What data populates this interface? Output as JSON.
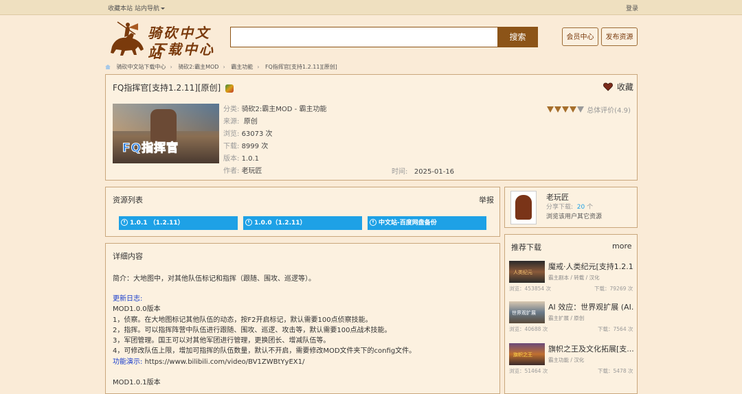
{
  "topbar": {
    "favorite": "收藏本站",
    "site_nav": "站内导航",
    "login": "登录"
  },
  "logo": {
    "line1": "骑砍中文站",
    "line2": "下载中心"
  },
  "search": {
    "placeholder": "",
    "button": "搜索"
  },
  "header_buttons": {
    "member": "会员中心",
    "publish": "发布资源"
  },
  "breadcrumb": [
    "骑砍中文站下载中心",
    "骑砍2:霸主MOD",
    "霸主功能",
    "FQ指挥官[支持1.2.11][原创]"
  ],
  "resource": {
    "title": "FQ指挥官[支持1.2.11][原创]",
    "favorite_label": "收藏",
    "thumb_text": "FQ指挥官",
    "rating_label": "总体评价(4.9)",
    "rating_value": 4.9,
    "fields": {
      "category": {
        "label": "分类:",
        "value": "骑砍2:霸主MOD - 霸主功能"
      },
      "source": {
        "label": "来源:",
        "value": "原创"
      },
      "views": {
        "label": "浏览:",
        "value": "63073 次"
      },
      "downloads": {
        "label": "下载:",
        "value": "8999 次"
      },
      "version": {
        "label": "版本:",
        "value": "1.0.1"
      },
      "author": {
        "label": "作者:",
        "value": "老玩匠"
      },
      "time": {
        "label": "时间:",
        "value": "2025-01-16"
      }
    }
  },
  "resource_list": {
    "title": "资源列表",
    "report": "举报",
    "buttons": [
      "1.0.1 （1.2.11）",
      "1.0.0（1.2.11）",
      "中文站-百度网盘备份"
    ]
  },
  "details": {
    "title": "详细内容",
    "intro": "简介：大地图中，对其他队伍标记和指挥（跟随、围攻、巡逻等）。",
    "changelog_label": "更新日志:",
    "v100": "MOD1.0.0版本",
    "items": [
      "1，侦察。在大地图标记其他队伍的动态，按F2开启标记，默认需要100点侦察技能。",
      "2，指挥。可以指挥阵营中队伍进行跟随、围攻、巡逻、攻击等，默认需要100点战术技能。",
      "3，军团管理。国王可以对其他军团进行管理，更换团长、增减队伍等。",
      "4，可修改队伍上限，增加可指挥的队伍数量，默认不开启，需要修改MOD文件夹下的config文件。"
    ],
    "demo_label": "功能演示:",
    "demo_url": "https://www.bilibili.com/video/BV1ZWBtYyEX1/",
    "v101": "MOD1.0.1版本"
  },
  "author_card": {
    "name": "老玩匠",
    "share_label": "分享下载:",
    "share_count": "20",
    "share_unit": "个",
    "link": "浏览该用户其它资源"
  },
  "recommend": {
    "title": "推荐下载",
    "more": "more",
    "items": [
      {
        "title": "魔戒·人类纪元[支持1.2.1...",
        "tags": "霸主剧本 / 转载 / 汉化",
        "views": "浏览：453854 次",
        "downloads": "下载：79269 次",
        "thumb_text": "人类纪元"
      },
      {
        "title": "AI 效应：世界观扩展 (AI...",
        "tags": "霸主扩展 / 原创",
        "views": "浏览：40688 次",
        "downloads": "下载：7564 次",
        "thumb_text": "世界观扩展"
      },
      {
        "title": "旗帜之王及文化拓展[支...",
        "tags": "霸主功能 / 汉化",
        "views": "浏览：51464 次",
        "downloads": "下载：5478 次",
        "thumb_text": "旗帜之王"
      }
    ]
  },
  "colors": {
    "accent": "#8c5418",
    "background": "#faebd7",
    "link_blue": "#1ea1e6",
    "panel_border": "#c9a77c"
  }
}
